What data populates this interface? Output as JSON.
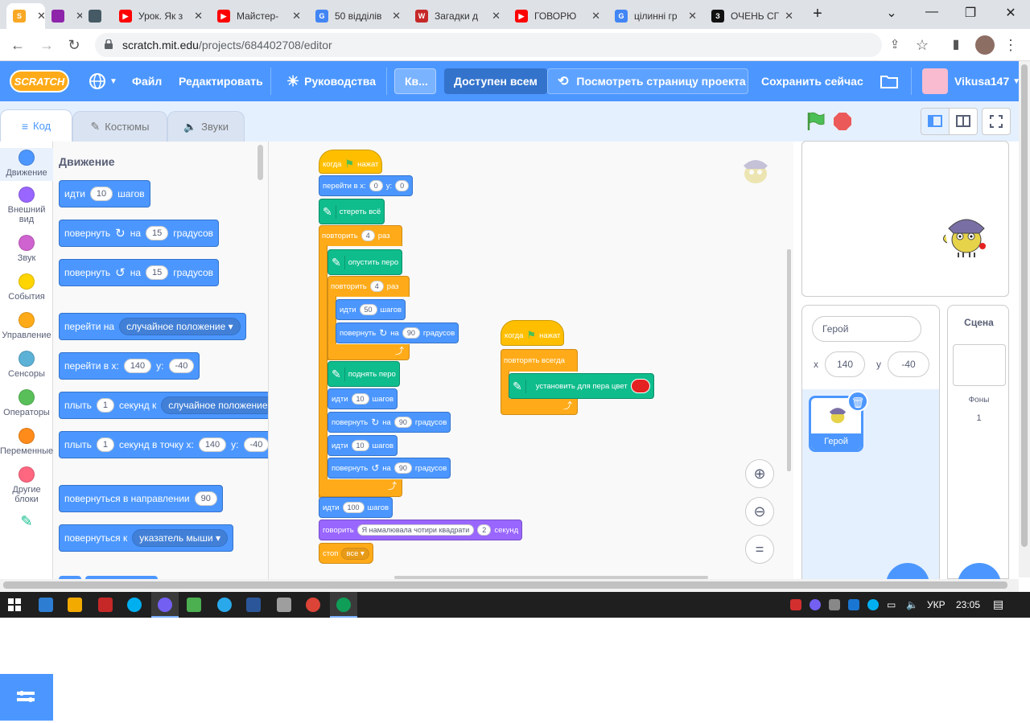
{
  "browser": {
    "tabs": [
      {
        "title": "",
        "color": "#f9a825",
        "glyph": "S"
      },
      {
        "title": "",
        "color": "#8e24aa",
        "glyph": ""
      },
      {
        "title": "",
        "color": "#455a64",
        "glyph": ""
      },
      {
        "title": "Урок. Як з",
        "color": "#ff0000",
        "glyph": "▶"
      },
      {
        "title": "Майстер-",
        "color": "#ff0000",
        "glyph": "▶"
      },
      {
        "title": "50 відділів",
        "color": "#4285f4",
        "glyph": "G"
      },
      {
        "title": "Загадки д",
        "color": "#c62828",
        "glyph": "W"
      },
      {
        "title": "ГОВОРЮ",
        "color": "#ff0000",
        "glyph": "▶"
      },
      {
        "title": "цілинні гр",
        "color": "#4285f4",
        "glyph": "G"
      },
      {
        "title": "ОЧЕНЬ СГ",
        "color": "#111111",
        "glyph": "З"
      }
    ],
    "url_domain": "scratch.mit.edu",
    "url_path": "/projects/684402708/editor"
  },
  "menu": {
    "logo": "SCRATCH",
    "file": "Файл",
    "edit": "Редактировать",
    "tutorials": "Руководства",
    "project_title": "Кв...",
    "share": "Доступен всем",
    "see_page": "Посмотреть страницу проекта",
    "save": "Сохранить сейчас",
    "username": "Vikusa147"
  },
  "tabs": {
    "code": "Код",
    "costumes": "Костюмы",
    "sounds": "Звуки"
  },
  "categories": [
    {
      "label": "Движение",
      "color": "#4c97ff"
    },
    {
      "label": "Внешний вид",
      "color": "#9966ff"
    },
    {
      "label": "Звук",
      "color": "#cf63cf"
    },
    {
      "label": "События",
      "color": "#ffd500"
    },
    {
      "label": "Управление",
      "color": "#ffab19"
    },
    {
      "label": "Сенсоры",
      "color": "#5cb1d6"
    },
    {
      "label": "Операторы",
      "color": "#59c059"
    },
    {
      "label": "Переменные",
      "color": "#ff8c1a"
    },
    {
      "label": "Другие блоки",
      "color": "#ff6680"
    }
  ],
  "palette": {
    "heading": "Движение",
    "move": {
      "a": "идти",
      "v": "10",
      "b": "шагов"
    },
    "turn_right": {
      "a": "повернуть",
      "b": "на",
      "v": "15",
      "c": "градусов"
    },
    "turn_left": {
      "a": "повернуть",
      "b": "на",
      "v": "15",
      "c": "градусов"
    },
    "goto": {
      "a": "перейти на",
      "dd": "случайное положение"
    },
    "goto_xy": {
      "a": "перейти в x:",
      "x": "140",
      "b": "y:",
      "y": "-40"
    },
    "glide": {
      "a": "плыть",
      "v": "1",
      "b": "секунд к",
      "dd": "случайное положение"
    },
    "glide_xy": {
      "a": "плыть",
      "v": "1",
      "b": "секунд в точку x:",
      "x": "140",
      "c": "y:",
      "y": "-40"
    },
    "point_dir": {
      "a": "повернуться в направлении",
      "v": "90"
    },
    "point_to": {
      "a": "повернуться к",
      "dd": "указатель мыши"
    }
  },
  "script1": {
    "hat": {
      "a": "когда",
      "b": "нажат"
    },
    "goto": {
      "a": "перейти в x:",
      "x": "0",
      "b": "y:",
      "y": "0"
    },
    "clear": "стереть всё",
    "repeat1": {
      "a": "повторить",
      "v": "4",
      "b": "раз"
    },
    "pen_down": "опустить перо",
    "repeat2": {
      "a": "повторить",
      "v": "4",
      "b": "раз"
    },
    "move50": {
      "a": "идти",
      "v": "50",
      "b": "шагов"
    },
    "turn90a": {
      "a": "повернуть",
      "b": "на",
      "v": "90",
      "c": "градусов"
    },
    "pen_up": "поднять перо",
    "move10a": {
      "a": "идти",
      "v": "10",
      "b": "шагов"
    },
    "turn90b": {
      "a": "повернуть",
      "b": "на",
      "v": "90",
      "c": "градусов"
    },
    "move10b": {
      "a": "идти",
      "v": "10",
      "b": "шагов"
    },
    "turn90c": {
      "a": "повернуть",
      "b": "на",
      "v": "90",
      "c": "градусов"
    },
    "move100": {
      "a": "идти",
      "v": "100",
      "b": "шагов"
    },
    "say": {
      "a": "говорить",
      "text": "Я намалювала чотири квадрати",
      "v": "2",
      "b": "секунд"
    },
    "stop": {
      "a": "стоп",
      "dd": "все"
    }
  },
  "script2": {
    "hat": {
      "a": "когда",
      "b": "нажат"
    },
    "forever": "повторять всегда",
    "set_color": "установить для пера цвет",
    "pen_color": "#e52222"
  },
  "sprite": {
    "name": "Герой",
    "x_label": "x",
    "x": "140",
    "y_label": "y",
    "y": "-40",
    "thumb_label": "Герой"
  },
  "scene": {
    "title": "Сцена",
    "backdrops_label": "Фоны",
    "backdrops_count": "1"
  },
  "taskbar": {
    "lang": "УКР",
    "time": "23:05"
  }
}
